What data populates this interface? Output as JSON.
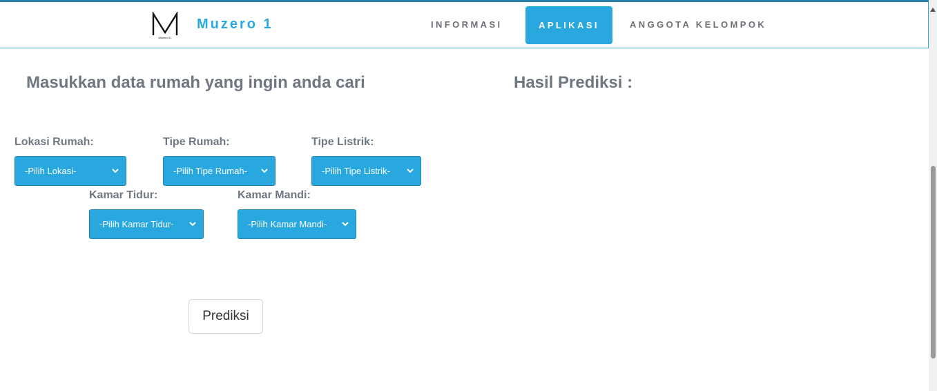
{
  "header": {
    "logo_letter": "M",
    "logo_caption": "Muzero 01",
    "brand": "Muzero 1",
    "nav": {
      "informasi": "INFORMASI",
      "aplikasi": "APLIKASI",
      "anggota": "ANGGOTA KELOMPOK"
    },
    "active_nav": "APLIKASI"
  },
  "main": {
    "form_heading": "Masukkan data rumah yang ingin anda cari",
    "result_heading": "Hasil Prediksi :",
    "fields": {
      "lokasi": {
        "label": "Lokasi Rumah:",
        "selected": "-Pilih Lokasi-"
      },
      "tipe_rumah": {
        "label": "Tipe Rumah:",
        "selected": "-Pilih Tipe Rumah-"
      },
      "tipe_listrik": {
        "label": "Tipe Listrik:",
        "selected": "-Pilih Tipe Listrik-"
      },
      "kamar_tidur": {
        "label": "Kamar Tidur:",
        "selected": "-Pilih Kamar Tidur-"
      },
      "kamar_mandi": {
        "label": "Kamar Mandi:",
        "selected": "-Pilih Kamar Mandi-"
      }
    },
    "submit_label": "Prediksi"
  },
  "colors": {
    "accent": "#29a8e0",
    "text_muted": "#6f7782",
    "nav_text": "#6b6f73"
  },
  "icons": {
    "select_chevron": "chevron-down-icon",
    "scroll_up": "scroll-up-arrow-icon"
  }
}
